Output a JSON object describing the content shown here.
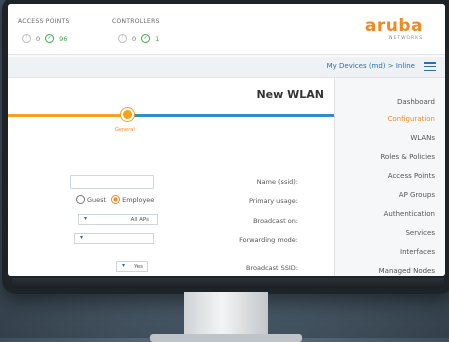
{
  "topbar": {
    "access_points_label": "ACCESS POINTS",
    "access_points_ok": "96",
    "access_points_other": "0",
    "controllers_label": "CONTROLLERS",
    "controllers_ok": "1",
    "controllers_other": "0",
    "logo": "aruba",
    "logo_sub": "NETWORKS"
  },
  "breadcrumb": "My Devices (md) > Inline",
  "page": {
    "title": "New WLAN",
    "step_label": "General"
  },
  "form": {
    "name_label": "Name (ssid):",
    "name_value": "",
    "primary_usage_label": "Primary usage:",
    "primary_usage_options": [
      "Employee",
      "Guest"
    ],
    "primary_usage_selected": "Employee",
    "broadcast_on_label": "Broadcast on:",
    "broadcast_on_value": "All APs",
    "forwarding_mode_label": "Forwarding mode:",
    "forwarding_mode_value": "",
    "broadcast_ssid_label": "Broadcast SSID:",
    "broadcast_ssid_value": "Yes"
  },
  "sidebar": {
    "items": [
      {
        "label": "Dashboard"
      },
      {
        "label": "Configuration"
      },
      {
        "label": "WLANs"
      },
      {
        "label": "Roles & Policies"
      },
      {
        "label": "Access Points"
      },
      {
        "label": "AP Groups"
      },
      {
        "label": "Authentication"
      },
      {
        "label": "Services"
      },
      {
        "label": "Interfaces"
      },
      {
        "label": "Managed Nodes"
      }
    ],
    "active_index": 1
  },
  "colors": {
    "brand": "#f08a24",
    "link": "#2b6fae",
    "ok": "#3ea64a"
  }
}
